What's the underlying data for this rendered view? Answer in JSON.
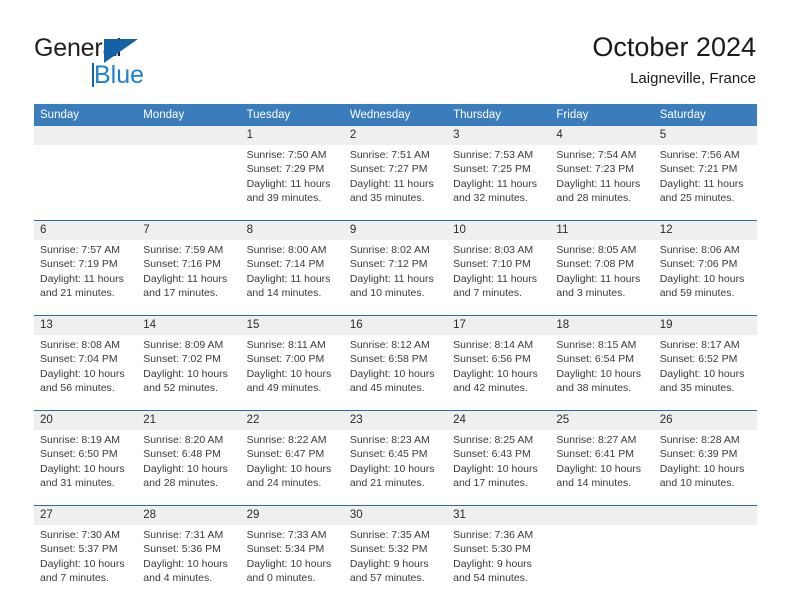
{
  "brand": {
    "name_top": "General",
    "name_bottom": "Blue",
    "triangle_color": "#1362a8",
    "blue_color": "#1b7fd4"
  },
  "header": {
    "title": "October 2024",
    "subtitle": "Laigneville, France"
  },
  "theme": {
    "header_bg": "#3b7cbd",
    "row_rule": "#2e6da4",
    "daynum_bg": "#efefef",
    "text": "#3a3a3a"
  },
  "weekday_headers": [
    "Sunday",
    "Monday",
    "Tuesday",
    "Wednesday",
    "Thursday",
    "Friday",
    "Saturday"
  ],
  "weeks": [
    {
      "days": [
        {
          "num": "",
          "sunrise": "",
          "sunset": "",
          "daylight_1": "",
          "daylight_2": "",
          "empty": true
        },
        {
          "num": "",
          "sunrise": "",
          "sunset": "",
          "daylight_1": "",
          "daylight_2": "",
          "empty": true
        },
        {
          "num": "1",
          "sunrise": "Sunrise: 7:50 AM",
          "sunset": "Sunset: 7:29 PM",
          "daylight_1": "Daylight: 11 hours",
          "daylight_2": "and 39 minutes."
        },
        {
          "num": "2",
          "sunrise": "Sunrise: 7:51 AM",
          "sunset": "Sunset: 7:27 PM",
          "daylight_1": "Daylight: 11 hours",
          "daylight_2": "and 35 minutes."
        },
        {
          "num": "3",
          "sunrise": "Sunrise: 7:53 AM",
          "sunset": "Sunset: 7:25 PM",
          "daylight_1": "Daylight: 11 hours",
          "daylight_2": "and 32 minutes."
        },
        {
          "num": "4",
          "sunrise": "Sunrise: 7:54 AM",
          "sunset": "Sunset: 7:23 PM",
          "daylight_1": "Daylight: 11 hours",
          "daylight_2": "and 28 minutes."
        },
        {
          "num": "5",
          "sunrise": "Sunrise: 7:56 AM",
          "sunset": "Sunset: 7:21 PM",
          "daylight_1": "Daylight: 11 hours",
          "daylight_2": "and 25 minutes."
        }
      ]
    },
    {
      "days": [
        {
          "num": "6",
          "sunrise": "Sunrise: 7:57 AM",
          "sunset": "Sunset: 7:19 PM",
          "daylight_1": "Daylight: 11 hours",
          "daylight_2": "and 21 minutes."
        },
        {
          "num": "7",
          "sunrise": "Sunrise: 7:59 AM",
          "sunset": "Sunset: 7:16 PM",
          "daylight_1": "Daylight: 11 hours",
          "daylight_2": "and 17 minutes."
        },
        {
          "num": "8",
          "sunrise": "Sunrise: 8:00 AM",
          "sunset": "Sunset: 7:14 PM",
          "daylight_1": "Daylight: 11 hours",
          "daylight_2": "and 14 minutes."
        },
        {
          "num": "9",
          "sunrise": "Sunrise: 8:02 AM",
          "sunset": "Sunset: 7:12 PM",
          "daylight_1": "Daylight: 11 hours",
          "daylight_2": "and 10 minutes."
        },
        {
          "num": "10",
          "sunrise": "Sunrise: 8:03 AM",
          "sunset": "Sunset: 7:10 PM",
          "daylight_1": "Daylight: 11 hours",
          "daylight_2": "and 7 minutes."
        },
        {
          "num": "11",
          "sunrise": "Sunrise: 8:05 AM",
          "sunset": "Sunset: 7:08 PM",
          "daylight_1": "Daylight: 11 hours",
          "daylight_2": "and 3 minutes."
        },
        {
          "num": "12",
          "sunrise": "Sunrise: 8:06 AM",
          "sunset": "Sunset: 7:06 PM",
          "daylight_1": "Daylight: 10 hours",
          "daylight_2": "and 59 minutes."
        }
      ]
    },
    {
      "days": [
        {
          "num": "13",
          "sunrise": "Sunrise: 8:08 AM",
          "sunset": "Sunset: 7:04 PM",
          "daylight_1": "Daylight: 10 hours",
          "daylight_2": "and 56 minutes."
        },
        {
          "num": "14",
          "sunrise": "Sunrise: 8:09 AM",
          "sunset": "Sunset: 7:02 PM",
          "daylight_1": "Daylight: 10 hours",
          "daylight_2": "and 52 minutes."
        },
        {
          "num": "15",
          "sunrise": "Sunrise: 8:11 AM",
          "sunset": "Sunset: 7:00 PM",
          "daylight_1": "Daylight: 10 hours",
          "daylight_2": "and 49 minutes."
        },
        {
          "num": "16",
          "sunrise": "Sunrise: 8:12 AM",
          "sunset": "Sunset: 6:58 PM",
          "daylight_1": "Daylight: 10 hours",
          "daylight_2": "and 45 minutes."
        },
        {
          "num": "17",
          "sunrise": "Sunrise: 8:14 AM",
          "sunset": "Sunset: 6:56 PM",
          "daylight_1": "Daylight: 10 hours",
          "daylight_2": "and 42 minutes."
        },
        {
          "num": "18",
          "sunrise": "Sunrise: 8:15 AM",
          "sunset": "Sunset: 6:54 PM",
          "daylight_1": "Daylight: 10 hours",
          "daylight_2": "and 38 minutes."
        },
        {
          "num": "19",
          "sunrise": "Sunrise: 8:17 AM",
          "sunset": "Sunset: 6:52 PM",
          "daylight_1": "Daylight: 10 hours",
          "daylight_2": "and 35 minutes."
        }
      ]
    },
    {
      "days": [
        {
          "num": "20",
          "sunrise": "Sunrise: 8:19 AM",
          "sunset": "Sunset: 6:50 PM",
          "daylight_1": "Daylight: 10 hours",
          "daylight_2": "and 31 minutes."
        },
        {
          "num": "21",
          "sunrise": "Sunrise: 8:20 AM",
          "sunset": "Sunset: 6:48 PM",
          "daylight_1": "Daylight: 10 hours",
          "daylight_2": "and 28 minutes."
        },
        {
          "num": "22",
          "sunrise": "Sunrise: 8:22 AM",
          "sunset": "Sunset: 6:47 PM",
          "daylight_1": "Daylight: 10 hours",
          "daylight_2": "and 24 minutes."
        },
        {
          "num": "23",
          "sunrise": "Sunrise: 8:23 AM",
          "sunset": "Sunset: 6:45 PM",
          "daylight_1": "Daylight: 10 hours",
          "daylight_2": "and 21 minutes."
        },
        {
          "num": "24",
          "sunrise": "Sunrise: 8:25 AM",
          "sunset": "Sunset: 6:43 PM",
          "daylight_1": "Daylight: 10 hours",
          "daylight_2": "and 17 minutes."
        },
        {
          "num": "25",
          "sunrise": "Sunrise: 8:27 AM",
          "sunset": "Sunset: 6:41 PM",
          "daylight_1": "Daylight: 10 hours",
          "daylight_2": "and 14 minutes."
        },
        {
          "num": "26",
          "sunrise": "Sunrise: 8:28 AM",
          "sunset": "Sunset: 6:39 PM",
          "daylight_1": "Daylight: 10 hours",
          "daylight_2": "and 10 minutes."
        }
      ]
    },
    {
      "days": [
        {
          "num": "27",
          "sunrise": "Sunrise: 7:30 AM",
          "sunset": "Sunset: 5:37 PM",
          "daylight_1": "Daylight: 10 hours",
          "daylight_2": "and 7 minutes."
        },
        {
          "num": "28",
          "sunrise": "Sunrise: 7:31 AM",
          "sunset": "Sunset: 5:36 PM",
          "daylight_1": "Daylight: 10 hours",
          "daylight_2": "and 4 minutes."
        },
        {
          "num": "29",
          "sunrise": "Sunrise: 7:33 AM",
          "sunset": "Sunset: 5:34 PM",
          "daylight_1": "Daylight: 10 hours",
          "daylight_2": "and 0 minutes."
        },
        {
          "num": "30",
          "sunrise": "Sunrise: 7:35 AM",
          "sunset": "Sunset: 5:32 PM",
          "daylight_1": "Daylight: 9 hours",
          "daylight_2": "and 57 minutes."
        },
        {
          "num": "31",
          "sunrise": "Sunrise: 7:36 AM",
          "sunset": "Sunset: 5:30 PM",
          "daylight_1": "Daylight: 9 hours",
          "daylight_2": "and 54 minutes."
        },
        {
          "num": "",
          "sunrise": "",
          "sunset": "",
          "daylight_1": "",
          "daylight_2": "",
          "empty": true
        },
        {
          "num": "",
          "sunrise": "",
          "sunset": "",
          "daylight_1": "",
          "daylight_2": "",
          "empty": true
        }
      ]
    }
  ]
}
